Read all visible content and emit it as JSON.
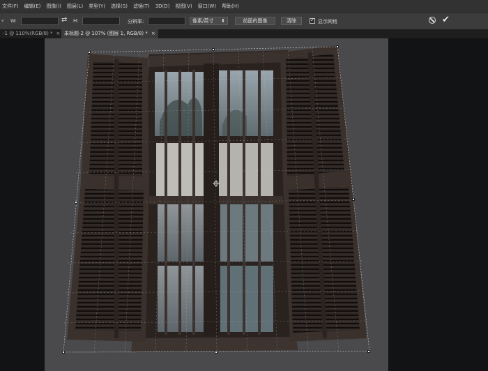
{
  "menu": [
    "文件(F)",
    "编辑(E)",
    "图像(I)",
    "图层(L)",
    "类型(Y)",
    "选择(S)",
    "滤镜(T)",
    "3D(D)",
    "视图(V)",
    "窗口(W)",
    "帮助(H)"
  ],
  "options": {
    "width_label": "W:",
    "height_label": "H:",
    "resolution_label": "分辨率:",
    "unit_select": "像素/英寸",
    "front_image_button": "前面的图像",
    "clear_button": "清除",
    "show_grid_label": "显示网格",
    "show_grid_checked": true
  },
  "tabs": [
    {
      "label": "-1 @ 110%(RGB/8) *",
      "close": "×"
    },
    {
      "label": "未标题-2 @ 107% (图层 1, RGB/8) *",
      "close": "×"
    }
  ],
  "icons": {
    "swap": "swap-icon",
    "cancel": "cancel-icon",
    "commit": "checkmark-icon"
  },
  "colors": {
    "menubar": "#323232",
    "optionsbar": "#3c3c3c",
    "workspace": "#121315",
    "canvas": "#4a4a4c"
  }
}
